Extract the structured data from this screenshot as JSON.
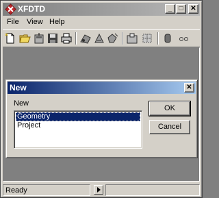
{
  "window": {
    "title": "XFDTD",
    "minimize_glyph": "_",
    "maximize_glyph": "□",
    "close_glyph": "✕"
  },
  "menu": [
    {
      "label": "File"
    },
    {
      "label": "View"
    },
    {
      "label": "Help"
    }
  ],
  "toolbar": {
    "tools": [
      "new-file-icon",
      "open-folder-icon",
      "import-geometry-icon",
      "save-icon",
      "print-icon",
      "cad-tool-a-icon",
      "cad-tool-b-icon",
      "cad-tool-c-icon",
      "project-icon",
      "mesh-icon",
      "cylinder-icon",
      "overflow-icon"
    ]
  },
  "status": {
    "text": "Ready",
    "nav_glyph": "▶"
  },
  "dialog": {
    "title": "New",
    "close_glyph": "✕",
    "label": "New",
    "items": [
      "Geometry",
      "Project"
    ],
    "selected_index": 0,
    "ok_label": "OK",
    "cancel_label": "Cancel"
  },
  "colors": {
    "app_titlebar_inactive": "#808080",
    "dialog_titlebar_active": "#0a246a",
    "selection": "#0a246a",
    "face": "#d4d0c8"
  }
}
